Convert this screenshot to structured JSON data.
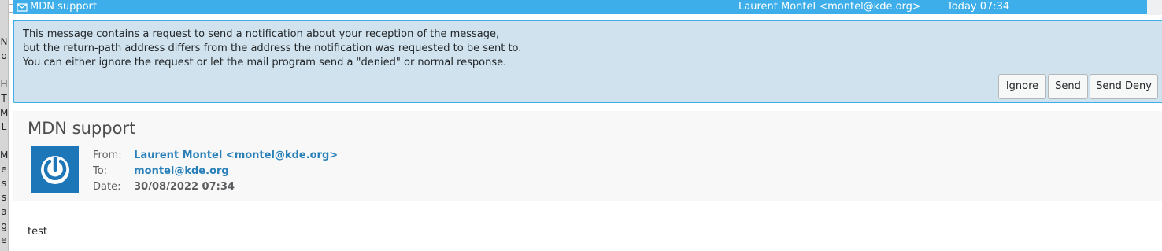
{
  "side_strip": {
    "letters": [
      "N",
      "o",
      "",
      "H",
      "T",
      "M",
      "L",
      "",
      "M",
      "e",
      "s",
      "s",
      "a",
      "g",
      "e"
    ]
  },
  "message_list": {
    "row": {
      "subject": "MDN support",
      "from": "Laurent Montel <montel@kde.org>",
      "date": "Today 07:34",
      "icon": "envelope-icon"
    }
  },
  "mdn_banner": {
    "lines": [
      "This message contains a request to send a notification about your reception of the message,",
      "but the return-path address differs from the address the notification was requested to be sent to.",
      "You can either ignore the request or let the mail program send a \"denied\" or normal response."
    ],
    "buttons": {
      "ignore": "Ignore",
      "send": "Send",
      "send_deny": "Send Deny"
    }
  },
  "header": {
    "subject": "MDN support",
    "avatar_icon": "power-icon",
    "fields": {
      "from_label": "From:",
      "from_value": "Laurent Montel <montel@kde.org>",
      "to_label": "To:",
      "to_value": "montel@kde.org",
      "date_label": "Date:",
      "date_value": "30/08/2022 07:34"
    }
  },
  "body": {
    "text": "test"
  },
  "colors": {
    "selection": "#3daee9",
    "banner_bg": "#cfe2ed",
    "link": "#2980b9",
    "avatar_bg": "#1d76b7"
  }
}
